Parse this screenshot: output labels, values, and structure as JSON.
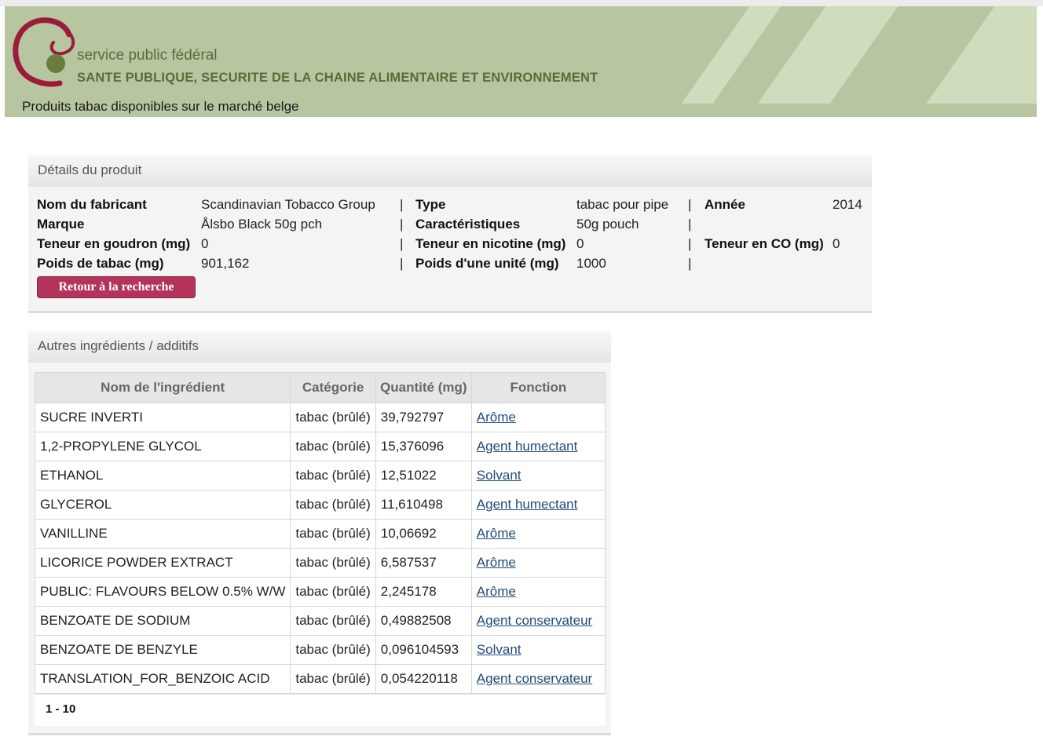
{
  "header": {
    "org_line1": "service public fédéral",
    "org_line2": "SANTE PUBLIQUE, SECURITE DE LA CHAINE ALIMENTAIRE  ET ENVIRONNEMENT",
    "subtitle": "Produits tabac disponibles sur le marché belge"
  },
  "details": {
    "title": "Détails du produit",
    "fields": {
      "manufacturer_label": "Nom du fabricant",
      "manufacturer_value": "Scandinavian Tobacco Group",
      "brand_label": "Marque",
      "brand_value": "Ålsbo Black 50g pch",
      "tar_label": "Teneur en goudron (mg)",
      "tar_value": "0",
      "tobacco_weight_label": "Poids de tabac (mg)",
      "tobacco_weight_value": "901,162",
      "type_label": "Type",
      "type_value": "tabac pour pipe",
      "characteristics_label": "Caractéristiques",
      "characteristics_value": "50g pouch",
      "nicotine_label": "Teneur en nicotine (mg)",
      "nicotine_value": "0",
      "unit_weight_label": "Poids d'une unité (mg)",
      "unit_weight_value": "1000",
      "year_label": "Année",
      "year_value": "2014",
      "co_label": "Teneur en CO (mg)",
      "co_value": "0",
      "separator": "|"
    },
    "back_button": "Retour à la recherche"
  },
  "additives": {
    "title": "Autres ingrédients / additifs",
    "columns": [
      "Nom de l'ingrédient",
      "Catégorie",
      "Quantité (mg)",
      "Fonction"
    ],
    "rows": [
      [
        "SUCRE INVERTI",
        "tabac (brûlé)",
        "39,792797",
        "Arôme"
      ],
      [
        "1,2-PROPYLENE GLYCOL",
        "tabac (brûlé)",
        "15,376096",
        "Agent humectant"
      ],
      [
        "ETHANOL",
        "tabac (brûlé)",
        "12,51022",
        "Solvant"
      ],
      [
        "GLYCEROL",
        "tabac (brûlé)",
        "11,610498",
        "Agent humectant"
      ],
      [
        "VANILLINE",
        "tabac (brûlé)",
        "10,06692",
        "Arôme"
      ],
      [
        "LICORICE POWDER EXTRACT",
        "tabac (brûlé)",
        "6,587537",
        "Arôme"
      ],
      [
        "PUBLIC: FLAVOURS BELOW 0.5% W/W",
        "tabac (brûlé)",
        "2,245178",
        "Arôme"
      ],
      [
        "BENZOATE DE SODIUM",
        "tabac (brûlé)",
        "0,49882508",
        "Agent conservateur"
      ],
      [
        "BENZOATE DE BENZYLE",
        "tabac (brûlé)",
        "0,096104593",
        "Solvant"
      ],
      [
        "TRANSLATION_FOR_BENZOIC ACID",
        "tabac (brûlé)",
        "0,054220118",
        "Agent conservateur"
      ]
    ],
    "pager": "1 - 10"
  },
  "colors": {
    "banner": "#b7c6a1",
    "logo_red": "#9b1b3a",
    "logo_green": "#6b7d3c",
    "button": "#b4335b",
    "link": "#1f4b7a"
  }
}
